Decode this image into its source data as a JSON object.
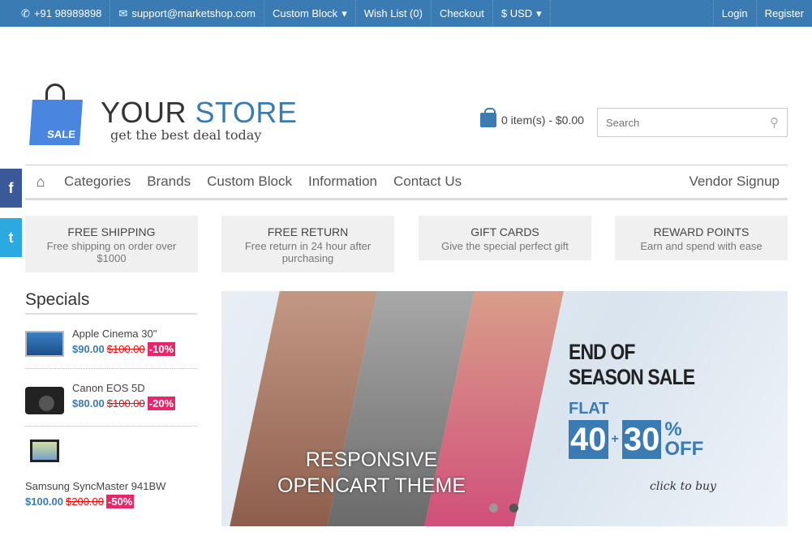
{
  "topbar": {
    "phone": "+91 98989898",
    "email": "support@marketshop.com",
    "custom_block": "Custom Block",
    "wishlist": "Wish List (0)",
    "checkout": "Checkout",
    "currency": "$ USD",
    "login": "Login",
    "register": "Register"
  },
  "logo": {
    "word1": "YOUR",
    "word2": "STORE",
    "tagline": "get the best deal today",
    "bag_text": "SALE"
  },
  "cart": {
    "label": "0 item(s) - $0.00"
  },
  "search": {
    "placeholder": "Search"
  },
  "nav": {
    "items": [
      "Categories",
      "Brands",
      "Custom Block",
      "Information",
      "Contact Us"
    ],
    "vendor": "Vendor Signup"
  },
  "social": {
    "facebook": "f",
    "twitter": "t"
  },
  "features": [
    {
      "title": "FREE SHIPPING",
      "text": "Free shipping on order over $1000"
    },
    {
      "title": "FREE RETURN",
      "text": "Free return in 24 hour after purchasing"
    },
    {
      "title": "GIFT CARDS",
      "text": "Give the special perfect gift"
    },
    {
      "title": "REWARD POINTS",
      "text": "Earn and spend with ease"
    }
  ],
  "specials": {
    "title": "Specials",
    "products": [
      {
        "name": "Apple Cinema 30\"",
        "price": "$90.00",
        "old": "$100.00",
        "discount": "-10%"
      },
      {
        "name": "Canon EOS 5D",
        "price": "$80.00",
        "old": "$100.00",
        "discount": "-20%"
      },
      {
        "name": "Samsung SyncMaster 941BW",
        "price": "$100.00",
        "old": "$200.00",
        "discount": "-50%"
      }
    ]
  },
  "banner": {
    "line1": "END OF",
    "line2": "SEASON SALE",
    "flat": "FLAT",
    "n1": "40",
    "plus": "+",
    "n2": "30",
    "pct": "%",
    "off": "OFF",
    "click": "click to buy",
    "resp1": "RESPONSIVE",
    "resp2": "OPENCART THEME"
  }
}
